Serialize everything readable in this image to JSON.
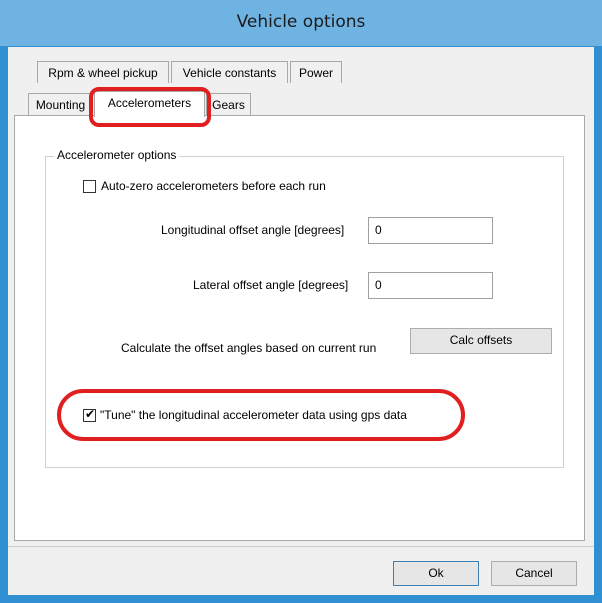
{
  "window": {
    "title": "Vehicle options"
  },
  "tabs": {
    "row1": [
      {
        "label": "Rpm & wheel pickup"
      },
      {
        "label": "Vehicle constants"
      },
      {
        "label": "Power"
      }
    ],
    "row2": [
      {
        "label": "Mounting"
      },
      {
        "label": "Accelerometers",
        "active": true
      },
      {
        "label": "Gears"
      }
    ]
  },
  "accelerometer_options": {
    "group_title": "Accelerometer options",
    "auto_zero": {
      "label": "Auto-zero accelerometers before each run",
      "checked": false
    },
    "longitudinal": {
      "label": "Longitudinal offset angle [degrees]",
      "value": "0"
    },
    "lateral": {
      "label": "Lateral offset angle [degrees]",
      "value": "0"
    },
    "calc": {
      "label": "Calculate the offset angles based on current run",
      "button": "Calc offsets"
    },
    "tune": {
      "label": "\"Tune\" the longitudinal accelerometer data using gps data",
      "checked": true
    }
  },
  "buttons": {
    "ok": "Ok",
    "cancel": "Cancel"
  },
  "colors": {
    "titlebar": "#6fb3e3",
    "border": "#2f8fd0",
    "highlight": "#e02020"
  }
}
